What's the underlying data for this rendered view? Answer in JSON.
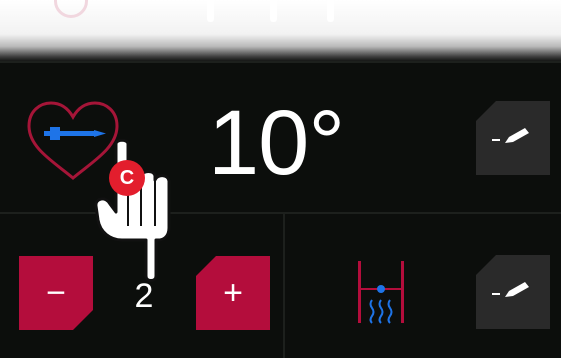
{
  "colors": {
    "accent_red": "#b40d3c",
    "heart_outline": "#a51538",
    "probe_blue": "#1e74e8",
    "background": "#0c0e0c",
    "edit_button_bg": "#2a2a2a",
    "touch_badge": "#e31e2d"
  },
  "header": {
    "icons": [
      "status-ring-icon",
      "indicator-pip",
      "indicator-pip",
      "indicator-pip"
    ]
  },
  "core_temp": {
    "icon": "heart-core-probe-icon",
    "value": "10°",
    "edit_icon": "edit-pencil-icon"
  },
  "stepper": {
    "minus_label": "−",
    "value": "2",
    "plus_label": "+"
  },
  "heating": {
    "icon": "bottom-heat-icon",
    "edit_icon": "edit-pencil-icon"
  },
  "touch_indicator": {
    "badge_label": "C",
    "icon": "pointing-hand-icon"
  }
}
